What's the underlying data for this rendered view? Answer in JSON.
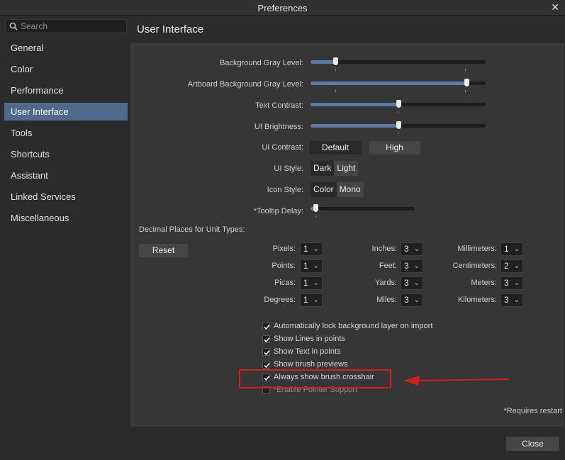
{
  "window": {
    "title": "Preferences"
  },
  "search": {
    "placeholder": "Search"
  },
  "sidebar": {
    "items": [
      {
        "label": "General",
        "active": false
      },
      {
        "label": "Color",
        "active": false
      },
      {
        "label": "Performance",
        "active": false
      },
      {
        "label": "User Interface",
        "active": true
      },
      {
        "label": "Tools",
        "active": false
      },
      {
        "label": "Shortcuts",
        "active": false
      },
      {
        "label": "Assistant",
        "active": false
      },
      {
        "label": "Linked Services",
        "active": false
      },
      {
        "label": "Miscellaneous",
        "active": false
      }
    ]
  },
  "page": {
    "title": "User Interface"
  },
  "sliders": [
    {
      "label": "Background Gray Level:",
      "value": 0.14
    },
    {
      "label": "Artboard Background Gray Level:",
      "value": 0.89
    },
    {
      "label": "Text Contrast:",
      "value": 0.5
    },
    {
      "label": "UI Brightness:",
      "value": 0.5
    }
  ],
  "ui_contrast": {
    "label": "UI Contrast:",
    "options": [
      "Default",
      "High"
    ],
    "selected": "Default"
  },
  "ui_style": {
    "label": "UI Style:",
    "options": [
      "Dark",
      "Light"
    ],
    "selected": "Dark"
  },
  "icon_style": {
    "label": "Icon Style:",
    "options": [
      "Color",
      "Mono"
    ],
    "selected": "Color"
  },
  "tooltip": {
    "label": "*Tooltip Delay:",
    "value": 0.05
  },
  "decimal": {
    "heading": "Decimal Places for Unit Types:",
    "reset_label": "Reset",
    "units": [
      {
        "label": "Pixels:",
        "value": "1"
      },
      {
        "label": "Points:",
        "value": "1"
      },
      {
        "label": "Picas:",
        "value": "1"
      },
      {
        "label": "Degrees:",
        "value": "1"
      },
      {
        "label": "Inches:",
        "value": "3"
      },
      {
        "label": "Feet:",
        "value": "3"
      },
      {
        "label": "Yards:",
        "value": "3"
      },
      {
        "label": "Miles:",
        "value": "3"
      },
      {
        "label": "Millimeters:",
        "value": "1"
      },
      {
        "label": "Centimeters:",
        "value": "2"
      },
      {
        "label": "Meters:",
        "value": "3"
      },
      {
        "label": "Kilometers:",
        "value": "3"
      }
    ]
  },
  "checkboxes": [
    {
      "label": "Automatically lock background layer on import",
      "checked": true
    },
    {
      "label": "Show Lines in points",
      "checked": true
    },
    {
      "label": "Show Text in points",
      "checked": true
    },
    {
      "label": "Show brush previews",
      "checked": true
    },
    {
      "label": "Always show brush crosshair",
      "checked": true
    },
    {
      "label": "*Enable Pointer Support",
      "checked": false
    }
  ],
  "footnote": "*Requires restart",
  "close_label": "Close",
  "colors": {
    "accent": "#5a7ba5",
    "highlight": "#d41f1f",
    "active_item": "#4f6a8c"
  }
}
